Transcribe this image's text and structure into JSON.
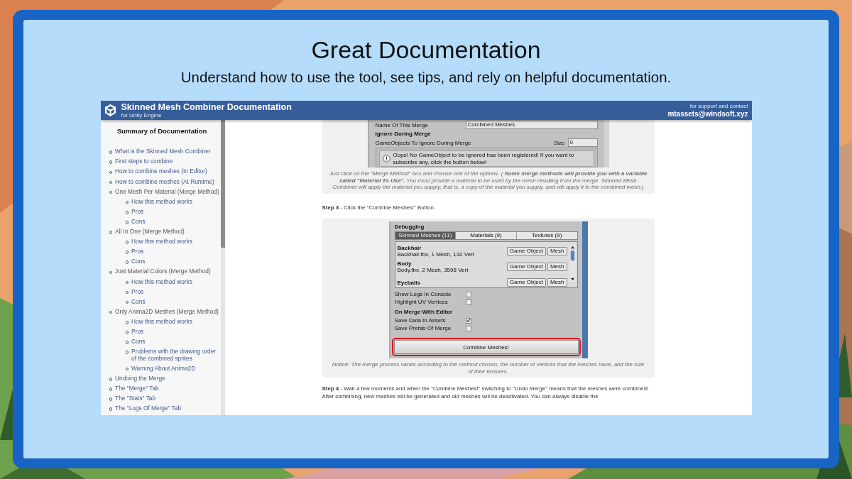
{
  "slide": {
    "title": "Great Documentation",
    "subtitle": "Understand how to use the tool, see tips, and rely on helpful documentation."
  },
  "header": {
    "title": "Skinned Mesh Combiner Documentation",
    "subtitle": "for Unity Engine",
    "support_label": "for support and contact",
    "email": "mtassets@windsoft.xyz"
  },
  "sidebar": {
    "title": "Summary of Documentation",
    "items": [
      {
        "label": "What is the Skinned Mesh Combiner",
        "kind": "link"
      },
      {
        "label": "First steps to combine",
        "kind": "link"
      },
      {
        "label": "How to combine meshes (In Editor)",
        "kind": "link"
      },
      {
        "label": "How to combine meshes (At Runtime)",
        "kind": "link"
      },
      {
        "label": "One Mesh Per Material (Merge Method)",
        "kind": "group",
        "children": [
          {
            "label": "How this method works"
          },
          {
            "label": "Pros"
          },
          {
            "label": "Cons"
          }
        ]
      },
      {
        "label": "All In One (Merge Method)",
        "kind": "group",
        "children": [
          {
            "label": "How this method works"
          },
          {
            "label": "Pros"
          },
          {
            "label": "Cons"
          }
        ]
      },
      {
        "label": "Just Material Colors (Merge Method)",
        "kind": "group",
        "children": [
          {
            "label": "How this method works"
          },
          {
            "label": "Pros"
          },
          {
            "label": "Cons"
          }
        ]
      },
      {
        "label": "Only Anima2D Meshes (Merge Method)",
        "kind": "group",
        "children": [
          {
            "label": "How this method works"
          },
          {
            "label": "Pros"
          },
          {
            "label": "Cons"
          },
          {
            "label": "Problems with the drawing order of the combined sprites"
          },
          {
            "label": "Warning About Anima2D"
          }
        ]
      },
      {
        "label": "Undoing the Merge",
        "kind": "link"
      },
      {
        "label": "The \"Merge\" Tab",
        "kind": "link"
      },
      {
        "label": "The \"Stats\" Tab",
        "kind": "link"
      },
      {
        "label": "The \"Logs Of Merge\" Tab",
        "kind": "link"
      }
    ]
  },
  "content": {
    "figure_1": {
      "name_label": "Name Of This Merge",
      "name_value": "Combined Meshes",
      "section": "Ignore During Merge",
      "list_label": "GameObjects To Ignore During Merge",
      "size_label": "Size",
      "size_value": "0",
      "warning": "Oops! No GameObject to be ignored has been registered! If you want to subscribe any, click the button below!"
    },
    "caption_1": "Just click on the \"Merge Method\" box and choose one of the options. ( **Some merge methods will provide you with a variable called \"Material To Use\".** You must provide a material to be used by the mesh resulting from the merge. Skinned Mesh Combiner will apply the material you supply, that is, a copy of the material you supply, and will apply it to the combined mesh.)",
    "step_3": "**Step 3** - Click the \"Combine Meshes!\" Button.",
    "figure_2": {
      "section": "Debugging",
      "tabs": [
        {
          "label": "Skinned Meshes (11)",
          "selected": true
        },
        {
          "label": "Materials (9)",
          "selected": false
        },
        {
          "label": "Textures (9)",
          "selected": false
        }
      ],
      "meshes": [
        {
          "name": "Backhair",
          "detail": "Backhair.fbx, 1 Mesh, 132 Vert",
          "object_button": "Game Object",
          "mesh_button": "Mesh"
        },
        {
          "name": "Body",
          "detail": "Body.fbx, 2 Mesh, 3598 Vert",
          "object_button": "Game Object",
          "mesh_button": "Mesh"
        },
        {
          "name": "Eyeballs",
          "object_button": "Game Object",
          "mesh_button": "Mesh"
        }
      ],
      "debug_options": [
        {
          "label": "Show Logs In Console",
          "checked": false
        },
        {
          "label": "Highlight UV Vertices",
          "checked": false
        }
      ],
      "merge_section": "On Merge With Editor",
      "merge_options": [
        {
          "label": "Save Data In Assets",
          "checked": true
        },
        {
          "label": "Save Prefab Of Merge",
          "checked": false
        }
      ],
      "combine_button": "Combine Meshes!",
      "highlighted": true
    },
    "caption_2": "Notice: The merge process varies according to the method chosen, the number of vertices that the meshes have, and the size of their textures.",
    "step_4": "**Step 4** - Wait a few moments and when the \"Combine Meshes!\" switching to \"Undo Merge\" means that the meshes were combined! After combining, new meshes will be generated and old meshes will be deactivated. You can always disable the"
  }
}
